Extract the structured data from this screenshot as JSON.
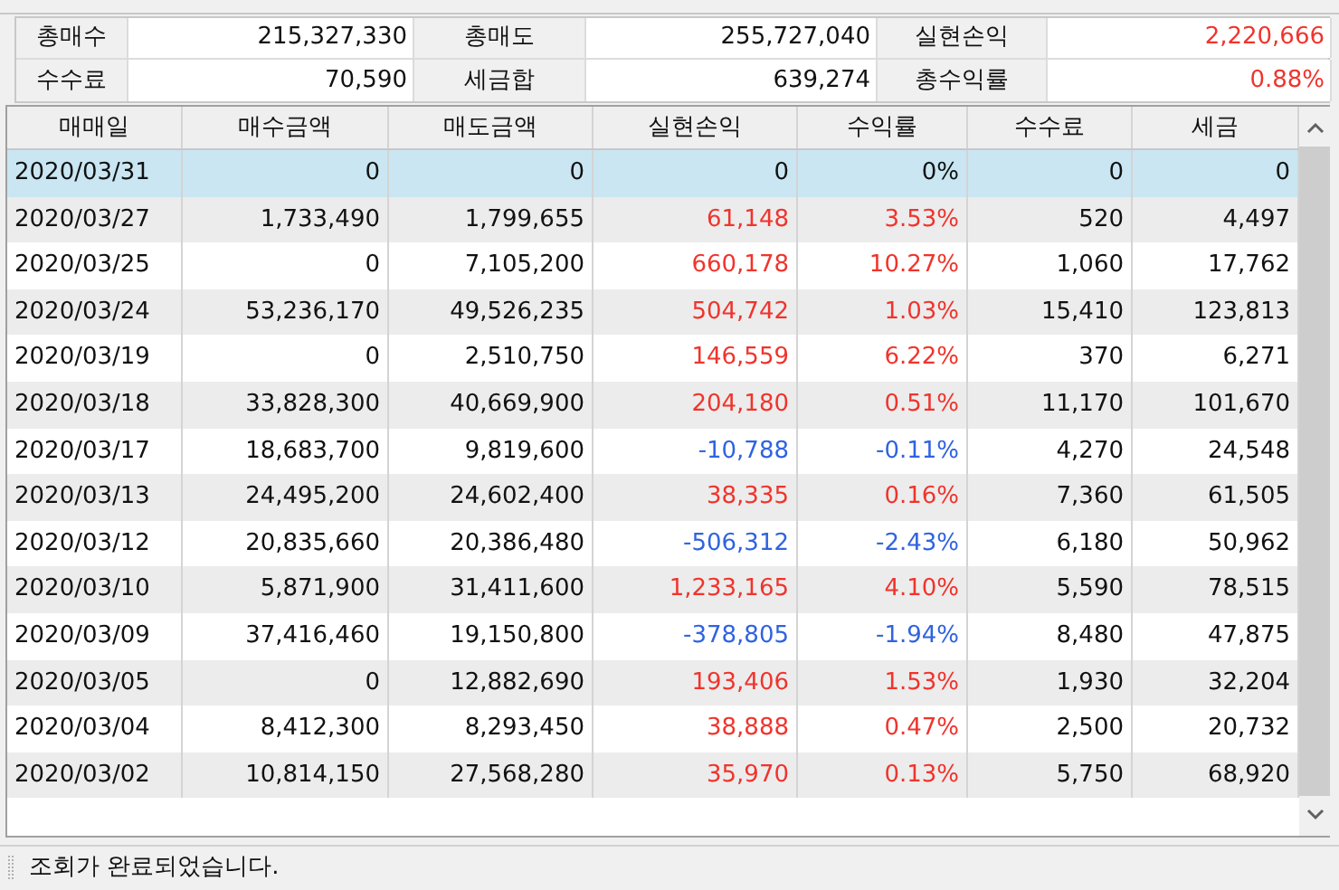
{
  "summary": [
    {
      "label": "총매수",
      "value": "215,327,330",
      "color": "#111111"
    },
    {
      "label": "총매도",
      "value": "255,727,040",
      "color": "#111111"
    },
    {
      "label": "실현손익",
      "value": "2,220,666",
      "color": "#f0342c"
    },
    {
      "label": "수수료",
      "value": "70,590",
      "color": "#111111"
    },
    {
      "label": "세금합",
      "value": "639,274",
      "color": "#111111"
    },
    {
      "label": "총수익률",
      "value": "0.88%",
      "color": "#f0342c"
    }
  ],
  "table": {
    "columns": [
      "매매일",
      "매수금액",
      "매도금액",
      "실현손익",
      "수익률",
      "수수료",
      "세금"
    ],
    "rows": [
      {
        "selected": true,
        "color": "#111111",
        "cells": [
          "2020/03/31",
          "0",
          "0",
          "0",
          "0%",
          "0",
          "0"
        ]
      },
      {
        "selected": false,
        "color": "#f0342c",
        "cells": [
          "2020/03/27",
          "1,733,490",
          "1,799,655",
          "61,148",
          "3.53%",
          "520",
          "4,497"
        ]
      },
      {
        "selected": false,
        "color": "#f0342c",
        "cells": [
          "2020/03/25",
          "0",
          "7,105,200",
          "660,178",
          "10.27%",
          "1,060",
          "17,762"
        ]
      },
      {
        "selected": false,
        "color": "#f0342c",
        "cells": [
          "2020/03/24",
          "53,236,170",
          "49,526,235",
          "504,742",
          "1.03%",
          "15,410",
          "123,813"
        ]
      },
      {
        "selected": false,
        "color": "#f0342c",
        "cells": [
          "2020/03/19",
          "0",
          "2,510,750",
          "146,559",
          "6.22%",
          "370",
          "6,271"
        ]
      },
      {
        "selected": false,
        "color": "#f0342c",
        "cells": [
          "2020/03/18",
          "33,828,300",
          "40,669,900",
          "204,180",
          "0.51%",
          "11,170",
          "101,670"
        ]
      },
      {
        "selected": false,
        "color": "#2f63e0",
        "cells": [
          "2020/03/17",
          "18,683,700",
          "9,819,600",
          "-10,788",
          "-0.11%",
          "4,270",
          "24,548"
        ]
      },
      {
        "selected": false,
        "color": "#f0342c",
        "cells": [
          "2020/03/13",
          "24,495,200",
          "24,602,400",
          "38,335",
          "0.16%",
          "7,360",
          "61,505"
        ]
      },
      {
        "selected": false,
        "color": "#2f63e0",
        "cells": [
          "2020/03/12",
          "20,835,660",
          "20,386,480",
          "-506,312",
          "-2.43%",
          "6,180",
          "50,962"
        ]
      },
      {
        "selected": false,
        "color": "#f0342c",
        "cells": [
          "2020/03/10",
          "5,871,900",
          "31,411,600",
          "1,233,165",
          "4.10%",
          "5,590",
          "78,515"
        ]
      },
      {
        "selected": false,
        "color": "#2f63e0",
        "cells": [
          "2020/03/09",
          "37,416,460",
          "19,150,800",
          "-378,805",
          "-1.94%",
          "8,480",
          "47,875"
        ]
      },
      {
        "selected": false,
        "color": "#f0342c",
        "cells": [
          "2020/03/05",
          "0",
          "12,882,690",
          "193,406",
          "1.53%",
          "1,930",
          "32,204"
        ]
      },
      {
        "selected": false,
        "color": "#f0342c",
        "cells": [
          "2020/03/04",
          "8,412,300",
          "8,293,450",
          "38,888",
          "0.47%",
          "2,500",
          "20,732"
        ]
      },
      {
        "selected": false,
        "color": "#f0342c",
        "cells": [
          "2020/03/02",
          "10,814,150",
          "27,568,280",
          "35,970",
          "0.13%",
          "5,750",
          "68,920"
        ]
      }
    ]
  },
  "status_bar": {
    "message": "조회가 완료되었습니다."
  }
}
